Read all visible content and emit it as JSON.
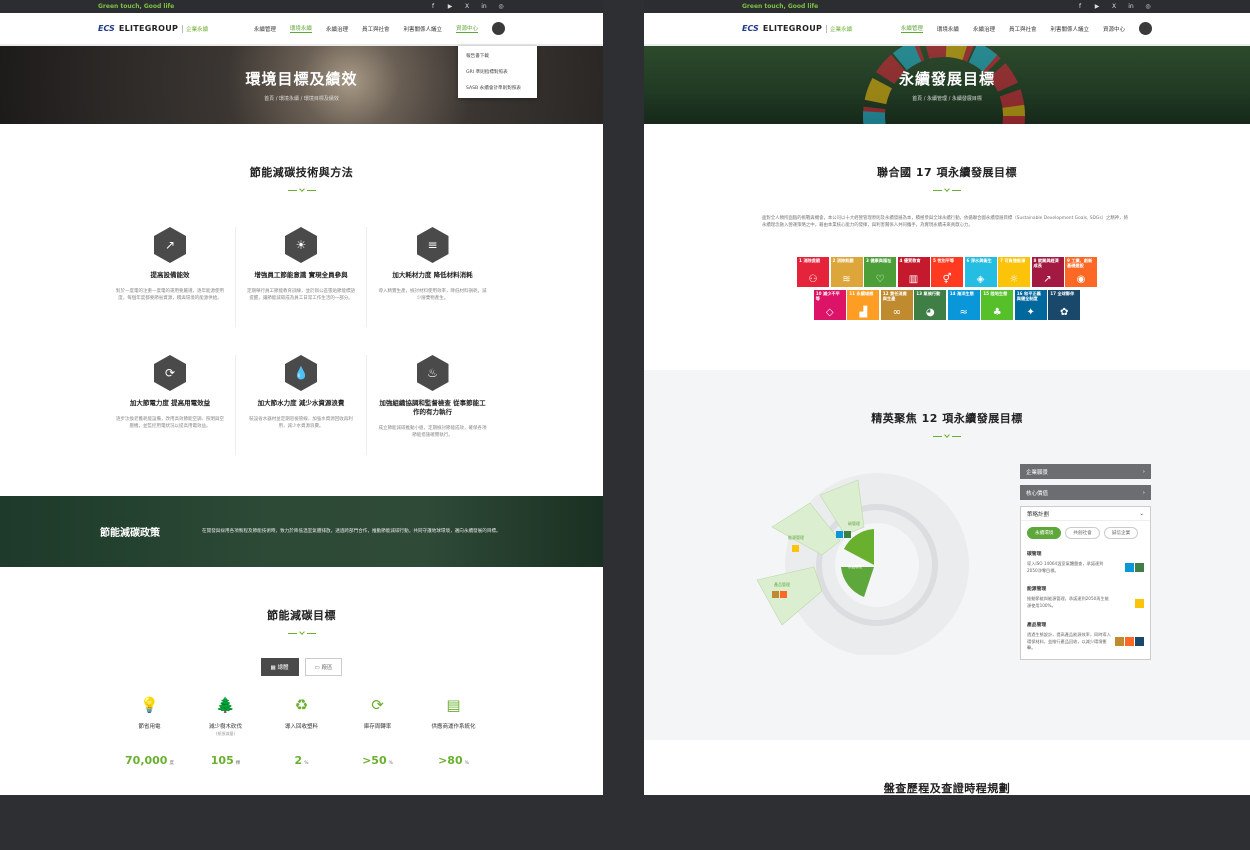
{
  "header": {
    "tagline": "Green touch, Good life",
    "logo_mark": "ECS",
    "brand": "ELITEGROUP",
    "brand_sub": "企業永續",
    "social_icons": [
      "facebook-icon",
      "youtube-icon",
      "x-icon",
      "linkedin-icon",
      "instagram-icon"
    ],
    "social_glyphs": [
      "f",
      "▶",
      "X",
      "in",
      "◎"
    ],
    "menu": [
      "永續管理",
      "環境永續",
      "永續治理",
      "員工與社會",
      "利害關係人議立",
      "資源中心"
    ],
    "menu_active_left": 1,
    "menu_active_right": 0,
    "search_glyph": "⌕"
  },
  "left": {
    "hero_title": "環境目標及績效",
    "breadcrumb": "首頁 / 環境永續 / 環境目標及績效",
    "dropdown": [
      "報告書下載",
      "GRI 準則指標對照表",
      "SASB 永續會計準則對照表"
    ],
    "section1_title": "節能減碳技術與方法",
    "methods": [
      {
        "icon": "↗",
        "title": "提高設備能效",
        "desc": "對於一度電的注重一度電的運用要嚴謹，逐年能源使用度，每個年度都要節省資源，積與環境的能源供給。"
      },
      {
        "icon": "☀",
        "title": "增強員工節能意識 實現全員參與",
        "desc": "定期舉行員工節能教育訓練，並於辦公區張貼節能標語提醒，讓節能減碳成為員工日常工作生活的一部分。"
      },
      {
        "icon": "≡",
        "title": "加大耗材力度 降低材料消耗",
        "desc": "導入精實生產，檢討材料使用效率，降低材料損耗，減少廢棄物產生。"
      },
      {
        "icon": "⟳",
        "title": "加大節電力度 提高用電效益",
        "desc": "逐步汰換老舊耗能設備，改用高效節能空調、照明與空壓機，並監控用電狀況以提高用電效益。"
      },
      {
        "icon": "💧",
        "title": "加大節水力度 減少水資源浪費",
        "desc": "裝設省水器材並定期巡檢管線，加強水資源回收再利用，減少水資源浪費。"
      },
      {
        "icon": "♨",
        "title": "加強組織協調和監督檢查 從事節能工作的有力執行",
        "desc": "成立節能減碳推動小組，定期檢討節能成效，確保各項節能措施確實執行。"
      }
    ],
    "policy_title": "節能減碳政策",
    "policy_text": "在開發與採用各項製程及節能技術時，致力於降低溫室氣體排放，透過跨部門合作，推動節能減碳行動，共同守護地球環境，邁向永續發展的目標。",
    "section2_title": "節能減碳目標",
    "tabs": [
      "總體",
      "廠區"
    ],
    "tab_icons": [
      "▦",
      "▭"
    ],
    "stats": [
      {
        "icon": "💡",
        "label": "節省用電",
        "sub": "",
        "value": "70,000",
        "unit": "度"
      },
      {
        "icon": "🌲",
        "label": "減少樹木砍伐",
        "sub": "(紙張減量)",
        "value": "105",
        "unit": "棵"
      },
      {
        "icon": "♻",
        "label": "導入回收塑料",
        "sub": "",
        "value": "2",
        "unit": "%"
      },
      {
        "icon": "⟳",
        "label": "庫存周轉率",
        "sub": "",
        "value": ">50",
        "unit": "%"
      },
      {
        "icon": "▤",
        "label": "供應商運作系統化",
        "sub": "",
        "value": ">80",
        "unit": "%"
      }
    ]
  },
  "right": {
    "hero_title": "永續發展目標",
    "breadcrumb": "首頁 / 永續管理 / 永續發展目標",
    "section1_title": "聯合國 17 項永續發展目標",
    "intro": "面對全人類所面臨的挑戰與機會，本公司以十大經營管理原則及永續發展為本，積極參與全球永續行動，依循聯合國永續發展目標（Sustainable Development Goals, SDGs）之精神，將永續理念融入營運策略之中，藉由本業核心能力的發揮，與利害關係人共同攜手，為實現永續未來貢獻心力。",
    "sdgs": [
      {
        "n": "1 消除貧窮",
        "color": "#e5243b",
        "g": "⚇"
      },
      {
        "n": "2 消除飢餓",
        "color": "#dda63a",
        "g": "≋"
      },
      {
        "n": "3 健康與福祉",
        "color": "#4c9f38",
        "g": "♡"
      },
      {
        "n": "4 優質教育",
        "color": "#c5192d",
        "g": "▥"
      },
      {
        "n": "5 性別平等",
        "color": "#ff3a21",
        "g": "⚥"
      },
      {
        "n": "6 淨水與衛生",
        "color": "#26bde2",
        "g": "◈"
      },
      {
        "n": "7 可負擔能源",
        "color": "#fcc30b",
        "g": "☼"
      },
      {
        "n": "8 就業與經濟成長",
        "color": "#a21942",
        "g": "↗"
      },
      {
        "n": "9 工業、創新基礎建設",
        "color": "#fd6925",
        "g": "◉"
      },
      {
        "n": "10 減少不平等",
        "color": "#dd1367",
        "g": "◇"
      },
      {
        "n": "11 永續城鄉",
        "color": "#fd9d24",
        "g": "▟"
      },
      {
        "n": "12 責任消費與生產",
        "color": "#bf8b2e",
        "g": "∞"
      },
      {
        "n": "13 氣候行動",
        "color": "#3f7e44",
        "g": "◕"
      },
      {
        "n": "14 海洋生態",
        "color": "#0a97d9",
        "g": "≈"
      },
      {
        "n": "15 陸地生態",
        "color": "#56c02b",
        "g": "♣"
      },
      {
        "n": "16 和平正義與健全制度",
        "color": "#00689d",
        "g": "✦"
      },
      {
        "n": "17 全球夥伴",
        "color": "#19486a",
        "g": "✿"
      }
    ],
    "section2_title": "精英聚焦 12 項永續發展目標",
    "wheel_labels": [
      "碳管理",
      "能源管理",
      "產品管理",
      "永續環境"
    ],
    "panel_buttons": [
      "企業願景",
      "核心價值"
    ],
    "plan_title": "策略計劃",
    "plan_tabs": [
      "永續環境",
      "共創社會",
      "誠信企業"
    ],
    "plan_items": [
      {
        "title": "碳管理",
        "desc": "導入ISO 14064溫室氣體盤查，承諾達到2050淨零目標。",
        "icons": [
          "#0a97d9",
          "#3f7e44"
        ]
      },
      {
        "title": "能源管理",
        "desc": "推動節能與能源管理，承諾達到2050再生能源使用100%。",
        "icons": [
          "#fcc30b"
        ]
      },
      {
        "title": "產品管理",
        "desc": "透過生態設計，提高產品能源效率，同時導入環保材料，並推行產品回收，以減少環境衝擊。",
        "icons": [
          "#bf8b2e",
          "#fd6925",
          "#19486a"
        ]
      }
    ],
    "section3_title": "盤查歷程及查證時程規劃"
  },
  "colors": {
    "accent": "#6ab02f",
    "dark": "#4a4a4a",
    "band": "#2c4a36"
  }
}
